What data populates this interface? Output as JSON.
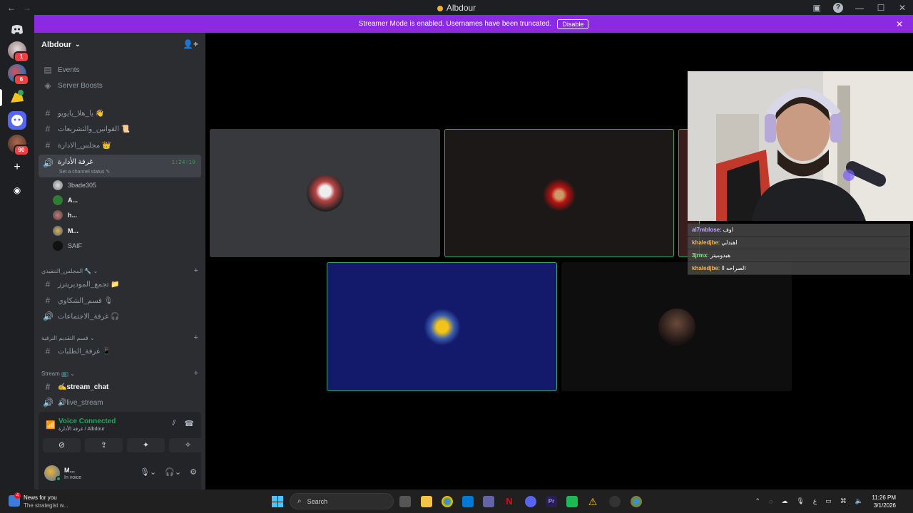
{
  "window": {
    "title": "Albdour",
    "back": "←",
    "forward": "→",
    "help": "?",
    "minimize": "—",
    "maximize": "☐",
    "close": "✕",
    "inbox": "▣"
  },
  "banner": {
    "text": "Streamer Mode is enabled. Usernames have been truncated.",
    "disable_label": "Disable",
    "close": "✕"
  },
  "guilds": [
    {
      "name": "discord-home",
      "badge": ""
    },
    {
      "name": "server-1",
      "badge": "1"
    },
    {
      "name": "server-2",
      "badge": "6"
    },
    {
      "name": "server-albdour",
      "badge": ""
    },
    {
      "name": "server-4",
      "badge": ""
    },
    {
      "name": "server-5",
      "badge": "90"
    },
    {
      "name": "add-server",
      "badge": ""
    },
    {
      "name": "discover",
      "badge": ""
    }
  ],
  "server": {
    "name": "Albdour",
    "chevron": "⌄",
    "invite_icon": "👤+"
  },
  "sidebar": {
    "events": "Events",
    "boosts": "Server Boosts",
    "channels_top": [
      {
        "icon": "#",
        "label": "يا_هلا_يايويو 👋"
      },
      {
        "icon": "#",
        "label": "القوانين_والتشريعات 📜"
      },
      {
        "icon": "#",
        "label": "مجلس_الادارة 👑"
      }
    ],
    "voice_channel": {
      "label": "غرفة الأدارة",
      "timer": "1:24:19",
      "status": "Set a channel status ✎"
    },
    "voice_users": [
      {
        "name": "3bade305",
        "bold": false
      },
      {
        "name": "A...",
        "bold": true
      },
      {
        "name": "h...",
        "bold": true
      },
      {
        "name": "M...",
        "bold": true
      },
      {
        "name": "SAIF",
        "bold": false
      }
    ],
    "categories": [
      {
        "label": "المجلس_التنفيذي 🔧 ⌄",
        "channels": [
          {
            "icon": "#",
            "label": "تجمع_الموديريترز 📁"
          },
          {
            "icon": "#",
            "label": "قسم_الشكاوي 🎙"
          },
          {
            "icon": "🔊",
            "label": "غرفة_الاجتماعات 🎧"
          }
        ]
      },
      {
        "label": "قسم التقديم الترقية ⌄",
        "channels": [
          {
            "icon": "#",
            "label": "غرفة_الطلبات 📱"
          }
        ]
      },
      {
        "label": "Stream 📺 ⌄",
        "channels": [
          {
            "icon": "#",
            "label": "✍stream_chat"
          },
          {
            "icon": "🔊",
            "label": "🔊live_stream"
          }
        ]
      }
    ],
    "plus": "+"
  },
  "voice_panel": {
    "status": "Voice Connected",
    "location": "غرفة الأدارة / Albdour",
    "me_name": "M...",
    "me_status": "In voice",
    "buttons": [
      "⊘",
      "⇪",
      "✦",
      "✧"
    ]
  },
  "chat_overlay": [
    {
      "user": "al7mblose",
      "text": "اوف",
      "color": "#c4a5ff"
    },
    {
      "user": "khaledjbe",
      "text": "اهبدلي",
      "color": "#f0b75a"
    },
    {
      "user": "3jrmx",
      "text": "هبدوميتر",
      "color": "#7cf07c"
    },
    {
      "user": "khaledjbe",
      "text": "الصراحه اا",
      "color": "#f0b75a"
    }
  ],
  "taskbar": {
    "news_title": "News for you",
    "news_sub": "The strategist w...",
    "news_badge": "4",
    "search_placeholder": "Search",
    "time": "11:26 PM",
    "date": "3/1/2026",
    "lang": "ع"
  }
}
